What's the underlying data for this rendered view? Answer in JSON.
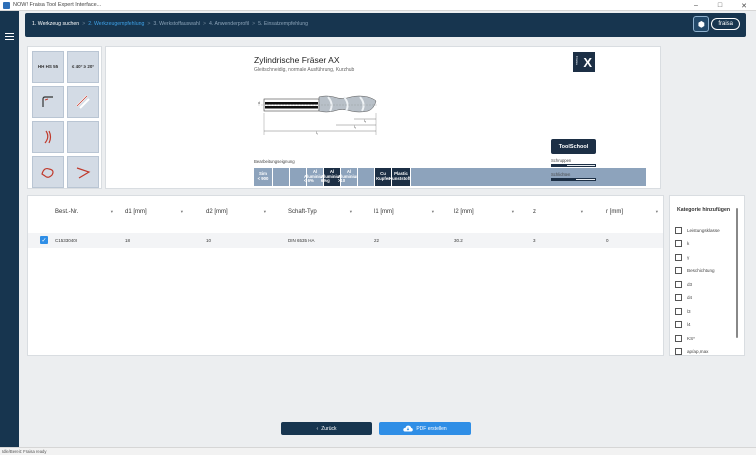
{
  "window": {
    "title": "NOW! Fraisa Tool Expert Interface..."
  },
  "nav": {
    "steps": [
      {
        "label": "1. Werkzeug suchen",
        "state": "done"
      },
      {
        "label": "2. Werkzeugempfehlung",
        "state": "active"
      },
      {
        "label": "3. Werkstoffauswahl",
        "state": "pending"
      },
      {
        "label": "4. Anwenderprofil",
        "state": "pending"
      },
      {
        "label": "5. Einsatzempfehlung",
        "state": "pending"
      }
    ],
    "separator": ">",
    "brand": "fraisa"
  },
  "tiles": [
    "HH HS 55",
    "≤ 40° ≥ 20°",
    "",
    "",
    "",
    "",
    "",
    ""
  ],
  "product": {
    "title": "Zylindrische Fräser AX",
    "subtitle": "Gleitschneidig, normale Ausführung, Kurzhub",
    "badge": "X",
    "badge_side": "Fraisa",
    "eignung_label": "Bearbeitungseignung",
    "materials": [
      {
        "top": "Sim",
        "bot": "< 900",
        "on": false
      },
      {
        "top": "",
        "bot": "",
        "on": false
      },
      {
        "top": "",
        "bot": "",
        "on": false
      },
      {
        "top": "Al",
        "bot": "Aluminium < 6%",
        "on": false
      },
      {
        "top": "Al",
        "bot": "Aluminium 6%g",
        "on": true
      },
      {
        "top": "Al",
        "bot": "Aluminium >10",
        "on": false
      },
      {
        "top": "",
        "bot": "",
        "on": false
      },
      {
        "top": "Cu",
        "bot": "Kupfer",
        "on": true
      },
      {
        "top": "Plastic",
        "bot": "Kunststoffe",
        "on": true
      }
    ],
    "toolschool": "ToolSchool",
    "meter_1": {
      "label": "Schruppen",
      "level": 0.35
    },
    "meter_2": {
      "label": "Schlichten",
      "level": 0.55
    }
  },
  "table": {
    "headers": [
      "Best.-Nr.",
      "d1 [mm]",
      "d2 [mm]",
      "Schaft-Typ",
      "l1 [mm]",
      "l2 [mm]",
      "z",
      "r [mm]"
    ],
    "rows": [
      {
        "checked": true,
        "cells": [
          "C1533040I",
          "18",
          "10",
          "DIN 6535 HA",
          "22",
          "30.2",
          "3",
          "0"
        ]
      }
    ]
  },
  "categories": {
    "title": "Kategorie hinzufügen",
    "items": [
      "Leistungsklasse",
      "k",
      "γ",
      "Beschichtung",
      "d3",
      "d4",
      "l3",
      "l4",
      "KS*",
      "ap/ap,max"
    ]
  },
  "buttons": {
    "back": "Zurück",
    "pdf": "PDF erstellen"
  },
  "statusbar": "Idle/Bereit: Fraisa ready"
}
